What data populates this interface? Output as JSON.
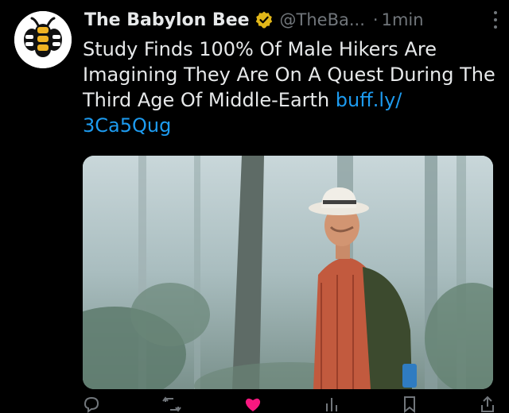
{
  "tweet": {
    "display_name": "The Babylon Bee",
    "handle": "@TheBa...",
    "separator": "·",
    "time": "1min",
    "text": "Study Finds 100% Of Male Hikers Are Imagining They Are On A Quest During The Third Age Of Middle-Earth ",
    "link_part1": "buff.ly/",
    "link_part2": "3Ca5Qug"
  },
  "icons": {
    "verified": "verified-badge-icon",
    "more": "more-options-icon",
    "reply": "reply-icon",
    "retweet": "retweet-icon",
    "like": "like-icon",
    "views": "views-icon",
    "bookmark": "bookmark-icon",
    "share": "share-icon"
  },
  "colors": {
    "background": "#000000",
    "text": "#e7e9ea",
    "muted": "#71767b",
    "link": "#1d9bf0",
    "verified": "#e2b719",
    "like": "#f91880",
    "bee_yellow": "#f0b323"
  }
}
